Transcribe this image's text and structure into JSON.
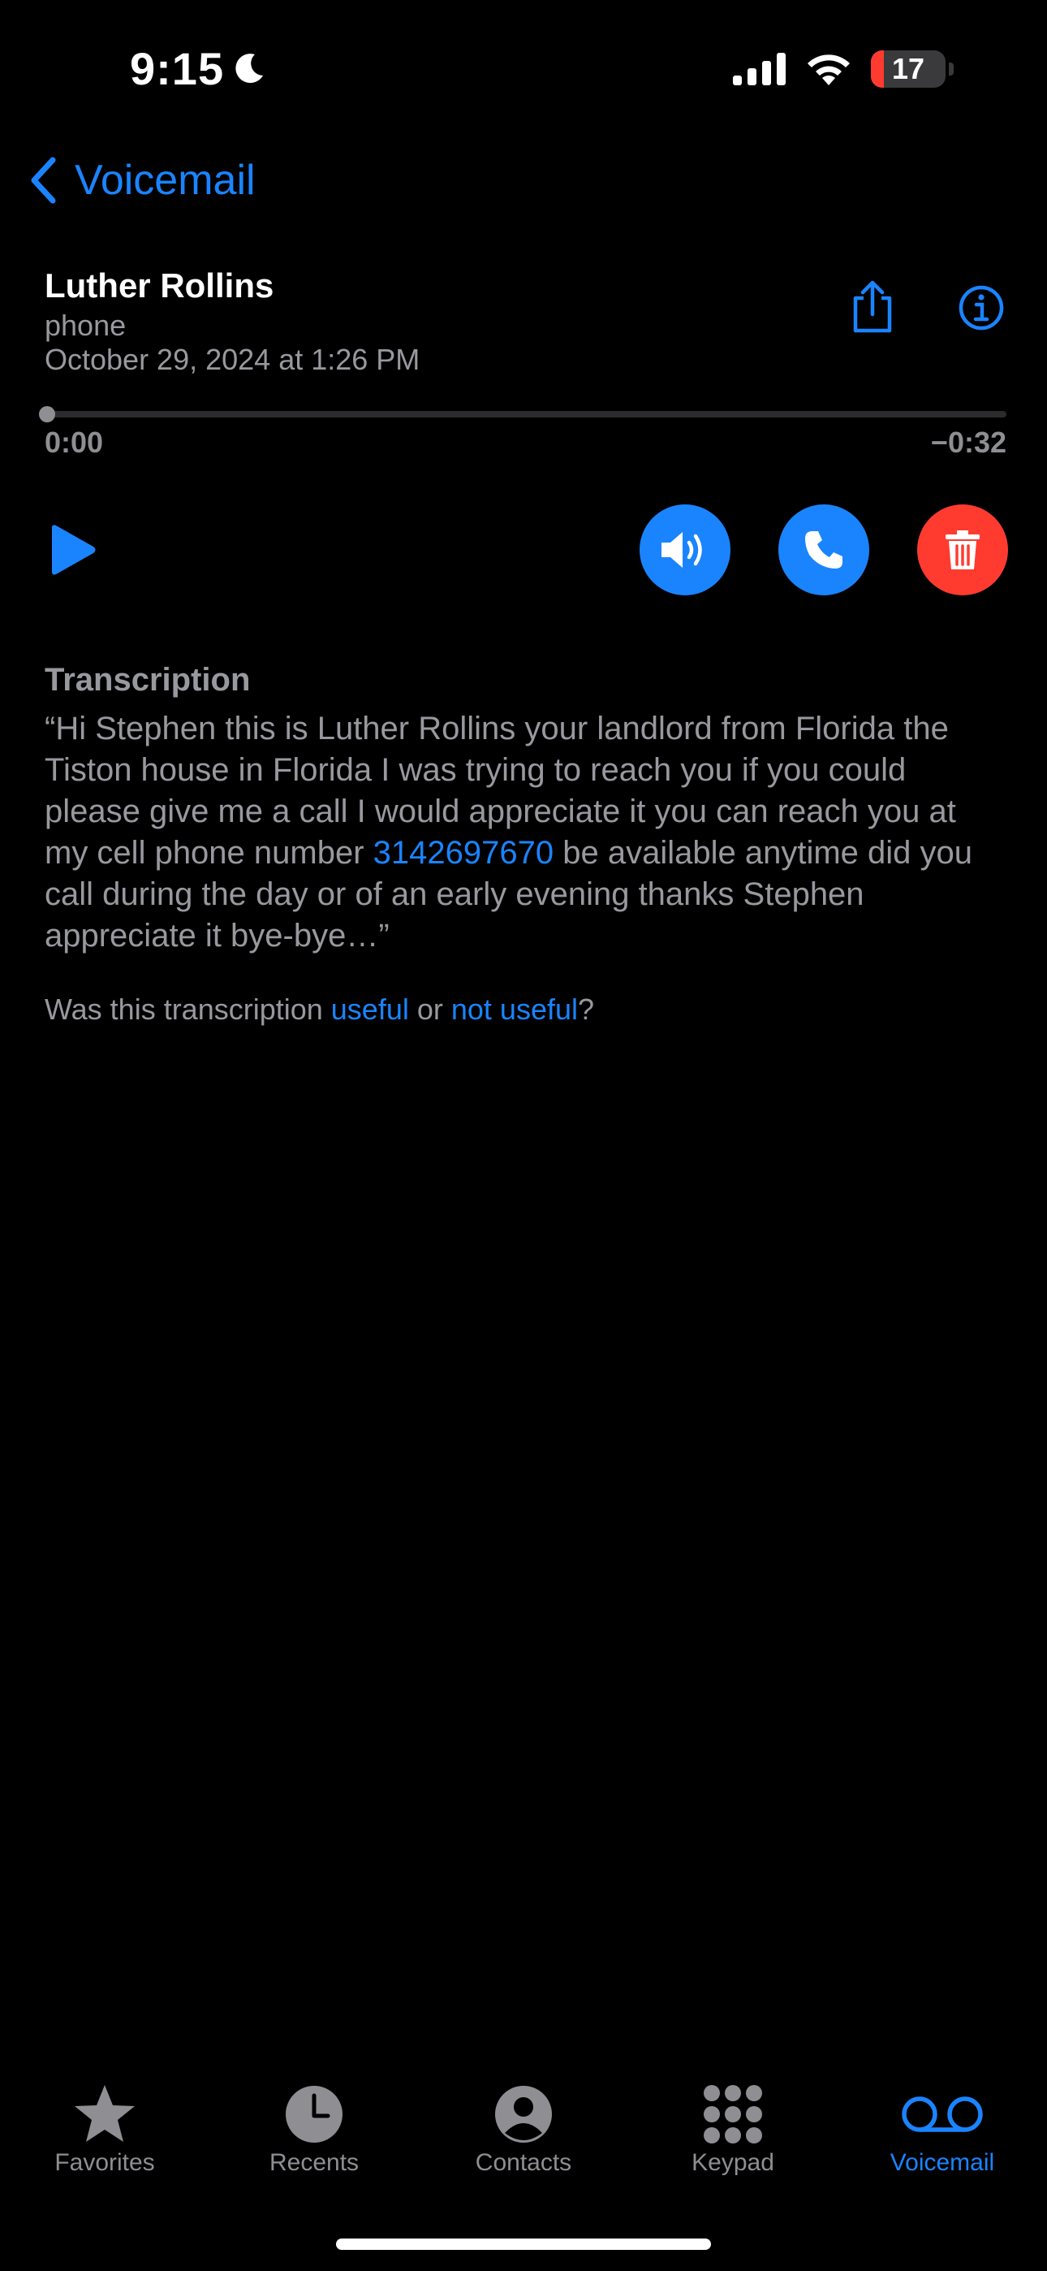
{
  "status_bar": {
    "time": "9:15",
    "battery_level": 17,
    "battery_color": "#ff3b30"
  },
  "nav": {
    "back_label": "Voicemail"
  },
  "voicemail": {
    "caller_name": "Luther Rollins",
    "caller_label": "phone",
    "date": "October 29, 2024 at 1:26 PM",
    "elapsed": "0:00",
    "remaining": "−0:32",
    "progress": 0
  },
  "transcription": {
    "title": "Transcription",
    "text_before": "“Hi Stephen this is Luther Rollins your landlord from Florida the Tiston house in Florida I was trying to reach you if you could please give me a call I would appreciate it you can reach you at my cell phone number ",
    "phone_link": "3142697670",
    "text_after": " be available anytime did you call during the day or of an early evening thanks Stephen appreciate it bye-bye…”",
    "feedback_prefix": "Was this transcription ",
    "useful_label": "useful",
    "feedback_or": " or ",
    "not_useful_label": "not useful",
    "feedback_suffix": "?"
  },
  "tabs": [
    {
      "label": "Favorites",
      "icon": "star-icon",
      "active": false
    },
    {
      "label": "Recents",
      "icon": "clock-icon",
      "active": false
    },
    {
      "label": "Contacts",
      "icon": "person-circle-icon",
      "active": false
    },
    {
      "label": "Keypad",
      "icon": "keypad-icon",
      "active": false
    },
    {
      "label": "Voicemail",
      "icon": "voicemail-icon",
      "active": true
    }
  ],
  "colors": {
    "accent": "#1a84ff",
    "destructive": "#ff3b30",
    "secondary_text": "#98989f",
    "background": "#000000"
  }
}
